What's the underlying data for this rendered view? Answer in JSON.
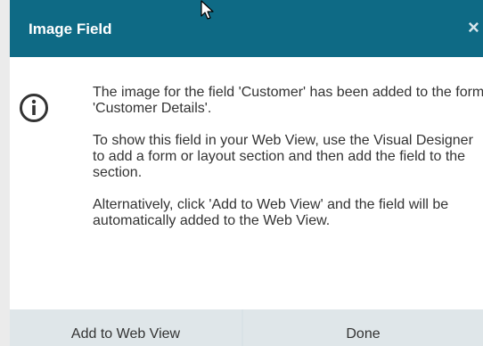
{
  "dialog": {
    "title": "Image Field",
    "close_glyph": "×",
    "icon": "info-circle-icon",
    "message": [
      "The image for the field 'Customer' has been added to the form 'Customer Details'.",
      "To show this field in your Web View, use the Visual Designer to add a form or layout section and then add the field to the section.",
      "Alternatively, click 'Add to Web View' and the field will be automatically added to the Web View."
    ],
    "buttons": {
      "add_label": "Add to Web View",
      "done_label": "Done"
    }
  },
  "colors": {
    "header": "#0e6a85",
    "footer": "#d9e2e6",
    "text": "#333333"
  }
}
